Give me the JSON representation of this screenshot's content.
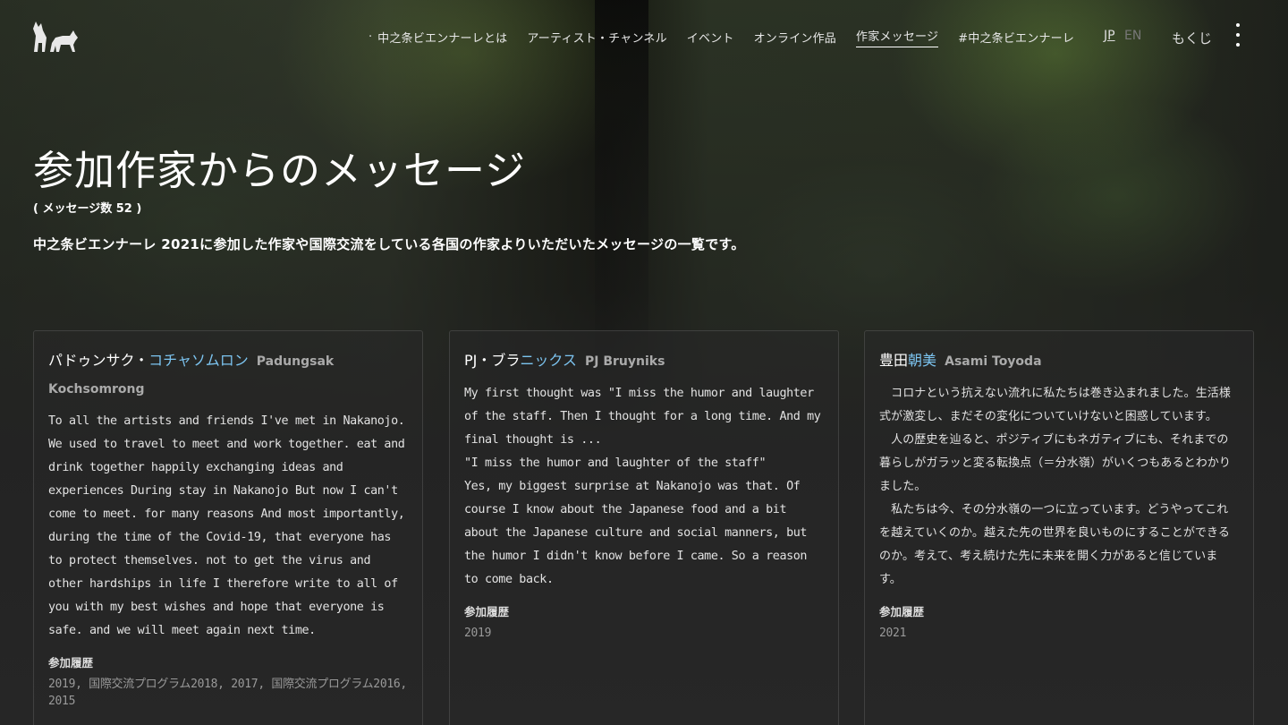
{
  "header": {
    "nav": [
      {
        "label": "中之条ビエンナーレとは"
      },
      {
        "label": "アーティスト・チャンネル"
      },
      {
        "label": "イベント"
      },
      {
        "label": "オンライン作品"
      },
      {
        "label": "作家メッセージ",
        "active": true
      },
      {
        "label": "#中之条ビエンナーレ"
      }
    ],
    "lang": {
      "jp": "JP",
      "en": "EN"
    },
    "toc": "もくじ",
    "logo_icon": "wolf-logo-icon",
    "menu_icon": "kebab-menu-icon"
  },
  "hero": {
    "title": "参加作家からのメッセージ",
    "count": "( メッセージ数 52 )",
    "lead": "中之条ビエンナーレ 2021に参加した作家や国際交流をしている各国の作家よりいただいたメッセージの一覧です。"
  },
  "cards": [
    {
      "name_ja_a": "パドゥンサク・",
      "name_ja_b": "コチャソムロン",
      "name_en": "Padungsak Kochsomrong",
      "body": "To all the artists and friends I've met in Nakanojo. We used to travel to meet and work together. eat and drink together happily exchanging ideas and experiences During stay in Nakanojo But now I can't come to meet. for many reasons And most importantly, during the time of the Covid-19, that everyone has to protect themselves. not to get the virus and other hardships in life I therefore write to all of you with my best wishes and hope that everyone is safe. and we will meet again next time.",
      "history_label": "参加履歴",
      "history": "2019, 国際交流プログラム2018, 2017, 国際交流プログラム2016, 2015"
    },
    {
      "name_ja_a": "PJ・ブラ",
      "name_ja_b": "ニックス",
      "name_en": "PJ Bruyniks",
      "body": "My first thought was \"I miss the humor and laughter of the staff. Then I thought for a long time. And my final thought is ...\n\"I miss the humor and laughter of the staff\"\nYes, my biggest surprise at Nakanojo was that. Of course I know about the Japanese food and a bit about the Japanese culture and social manners, but the humor I didn't know before I came. So a reason to come back.",
      "history_label": "参加履歴",
      "history": "2019"
    },
    {
      "name_ja_a": "豊田",
      "name_ja_b": "朝美",
      "name_en": "Asami Toyoda",
      "body": "　コロナという抗えない流れに私たちは巻き込まれました。生活様式が激変し、まだその変化についていけないと困惑しています。\n　人の歴史を辿ると、ポジティブにもネガティブにも、それまでの暮らしがガラッと変る転換点（＝分水嶺）がいくつもあるとわかりました。\n　私たちは今、その分水嶺の一つに立っています。どうやってこれを越えていくのか。越えた先の世界を良いものにすることができるのか。考えて、考え続けた先に未来を開く力があると信じています。",
      "history_label": "参加履歴",
      "history": "2021"
    }
  ]
}
